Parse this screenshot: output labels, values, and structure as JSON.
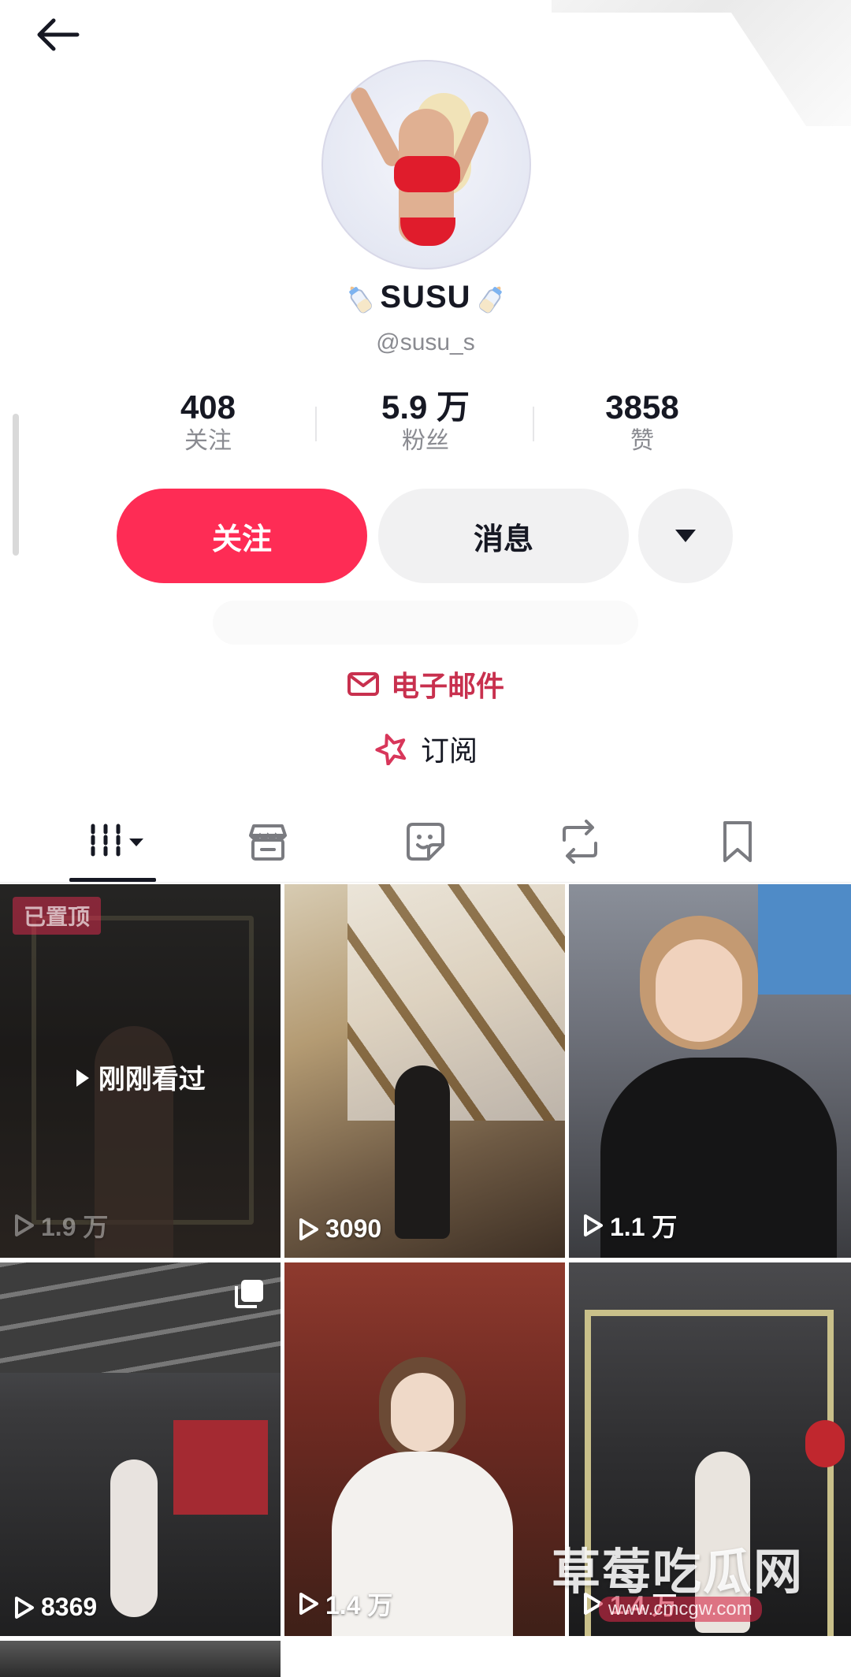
{
  "header": {
    "back_icon": "arrow-left-icon"
  },
  "profile": {
    "name": "SUSU",
    "handle": "@susu_s",
    "stats": [
      {
        "value": "408",
        "label": "关注"
      },
      {
        "value": "5.9 万",
        "label": "粉丝"
      },
      {
        "value": "3858",
        "label": "赞"
      }
    ]
  },
  "actions": {
    "follow_label": "关注",
    "message_label": "消息",
    "more_icon": "caret-down-icon"
  },
  "links": {
    "email_label": "电子邮件",
    "subscribe_label": "订阅"
  },
  "tabs": [
    {
      "icon": "grid-videos-icon",
      "active": true
    },
    {
      "icon": "shop-icon",
      "active": false
    },
    {
      "icon": "sticker-icon",
      "active": false
    },
    {
      "icon": "repost-icon",
      "active": false
    },
    {
      "icon": "bookmark-icon",
      "active": false
    }
  ],
  "videos": [
    {
      "views": "1.9 万",
      "pinned_label": "已置顶",
      "recent_label": "刚刚看过"
    },
    {
      "views": "3090"
    },
    {
      "views": "1.1 万"
    },
    {
      "views": "8369",
      "multi": true
    },
    {
      "views": "1.4 万"
    },
    {
      "views": "1.4 万"
    }
  ],
  "watermark": {
    "text": "草莓吃瓜网",
    "url": "www.cmcgw.com"
  },
  "colors": {
    "accent": "#fe2c55",
    "link": "#c8304e",
    "text": "#161823",
    "muted": "#8a8b91"
  }
}
